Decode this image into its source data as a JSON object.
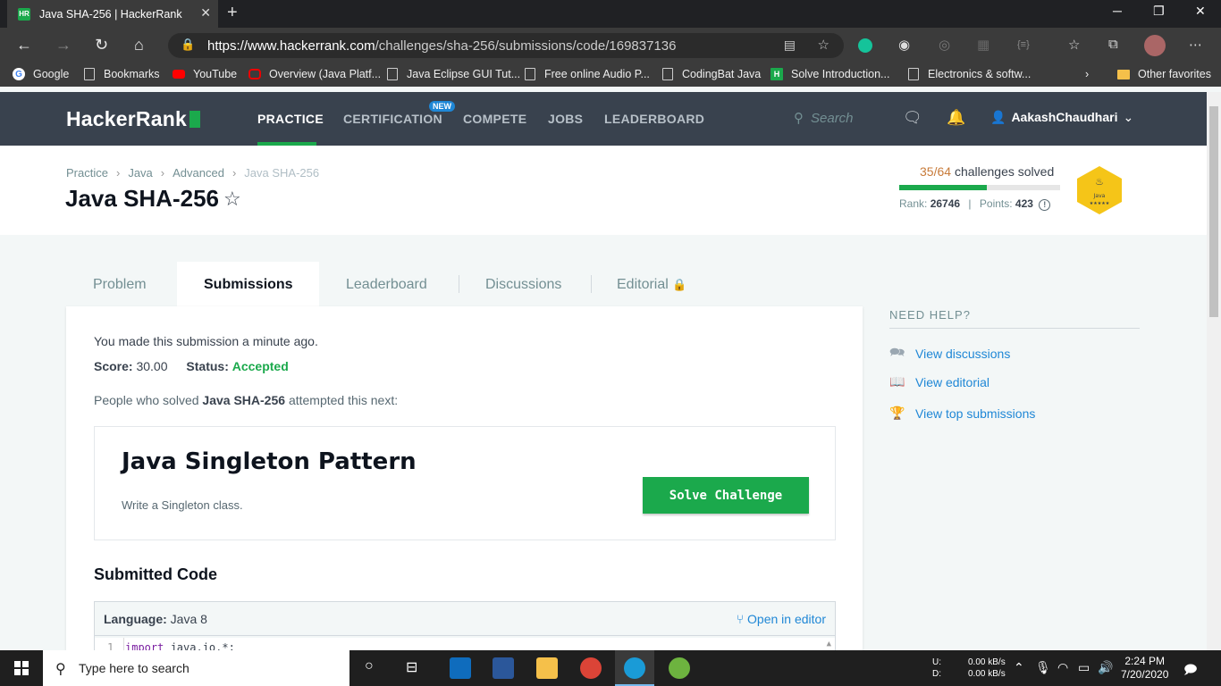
{
  "browser": {
    "tab_title": "Java SHA-256 | HackerRank",
    "tab_favicon": "HR",
    "url_host": "https://www.hackerrank.com",
    "url_path": "/challenges/sha-256/submissions/code/169837136",
    "bookmarks": [
      "Google",
      "Bookmarks",
      "YouTube",
      "Overview (Java Platf...",
      "Java Eclipse GUI Tut...",
      "Free online Audio P...",
      "CodingBat Java",
      "Solve Introduction...",
      "Electronics & softw..."
    ],
    "other_favorites": "Other favorites"
  },
  "nav": {
    "logo": "HackerRank",
    "items": [
      "PRACTICE",
      "CERTIFICATION",
      "COMPETE",
      "JOBS",
      "LEADERBOARD"
    ],
    "new_badge": "NEW",
    "search_placeholder": "Search",
    "username": "AakashChaudhari"
  },
  "header": {
    "breadcrumb": [
      "Practice",
      "Java",
      "Advanced",
      "Java SHA-256"
    ],
    "title": "Java SHA-256",
    "solved_count": "35/64",
    "solved_label": "challenges solved",
    "progress_fraction": 0.547,
    "rank_label": "Rank:",
    "rank": "26746",
    "points_label": "Points:",
    "points": "423",
    "badge_label": "Java"
  },
  "tabs": [
    "Problem",
    "Submissions",
    "Leaderboard",
    "Discussions",
    "Editorial"
  ],
  "submission": {
    "made_text": "You made this submission a minute ago.",
    "score_label": "Score:",
    "score": "30.00",
    "status_label": "Status:",
    "status": "Accepted",
    "next_prefix": "People who solved",
    "next_challenge_name": "Java SHA-256",
    "next_suffix": "attempted this next:",
    "next_title": "Java Singleton Pattern",
    "next_desc": "Write a Singleton class.",
    "solve_button": "Solve Challenge",
    "submitted_code_heading": "Submitted Code",
    "language_label": "Language:",
    "language": "Java 8",
    "open_in_editor": "Open in editor",
    "code_line_number": "1",
    "code_line_keyword": "import",
    "code_line_text": " java.io.*;"
  },
  "help": {
    "heading": "NEED HELP?",
    "links": [
      "View discussions",
      "View editorial",
      "View top submissions"
    ]
  },
  "taskbar": {
    "search_placeholder": "Type here to search",
    "net_up_label": "U:",
    "net_down_label": "D:",
    "net_up": "0.00 kB/s",
    "net_down": "0.00 kB/s",
    "time": "2:24 PM",
    "date": "7/20/2020"
  },
  "colors": {
    "accent": "#1ba94c",
    "nav_bg": "#39424e",
    "link": "#1f87d6",
    "badge": "#f5c518"
  }
}
